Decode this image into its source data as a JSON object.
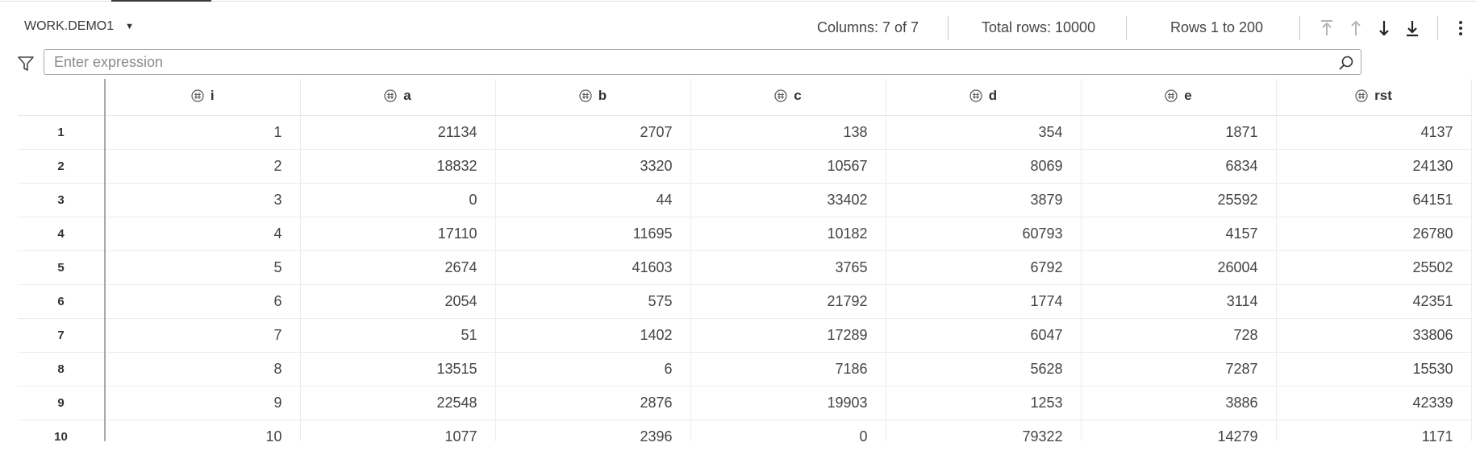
{
  "dataset": {
    "name": "WORK.DEMO1"
  },
  "status": {
    "columns": "Columns: 7 of 7",
    "total_rows": "Total rows: 10000",
    "rows_range": "Rows 1 to 200"
  },
  "navigation": {
    "icons": [
      "first-page-icon",
      "previous-page-icon",
      "next-page-icon",
      "last-page-icon"
    ]
  },
  "filter": {
    "placeholder": "Enter expression",
    "value": ""
  },
  "table": {
    "columns": [
      "i",
      "a",
      "b",
      "c",
      "d",
      "e",
      "rst"
    ],
    "rows": [
      [
        "1",
        "1",
        "21134",
        "2707",
        "138",
        "354",
        "1871",
        "4137"
      ],
      [
        "2",
        "2",
        "18832",
        "3320",
        "10567",
        "8069",
        "6834",
        "24130"
      ],
      [
        "3",
        "3",
        "0",
        "44",
        "33402",
        "3879",
        "25592",
        "64151"
      ],
      [
        "4",
        "4",
        "17110",
        "11695",
        "10182",
        "60793",
        "4157",
        "26780"
      ],
      [
        "5",
        "5",
        "2674",
        "41603",
        "3765",
        "6792",
        "26004",
        "25502"
      ],
      [
        "6",
        "6",
        "2054",
        "575",
        "21792",
        "1774",
        "3114",
        "42351"
      ],
      [
        "7",
        "7",
        "51",
        "1402",
        "17289",
        "6047",
        "728",
        "33806"
      ],
      [
        "8",
        "8",
        "13515",
        "6",
        "7186",
        "5628",
        "7287",
        "15530"
      ],
      [
        "9",
        "9",
        "22548",
        "2876",
        "19903",
        "1253",
        "3886",
        "42339"
      ],
      [
        "10",
        "10",
        "1077",
        "2396",
        "0",
        "79322",
        "14279",
        "1171"
      ]
    ]
  },
  "colors": {
    "text": "#3a3a3a",
    "disabled_icon": "#b5b5b5",
    "border": "#a9a9a9"
  }
}
